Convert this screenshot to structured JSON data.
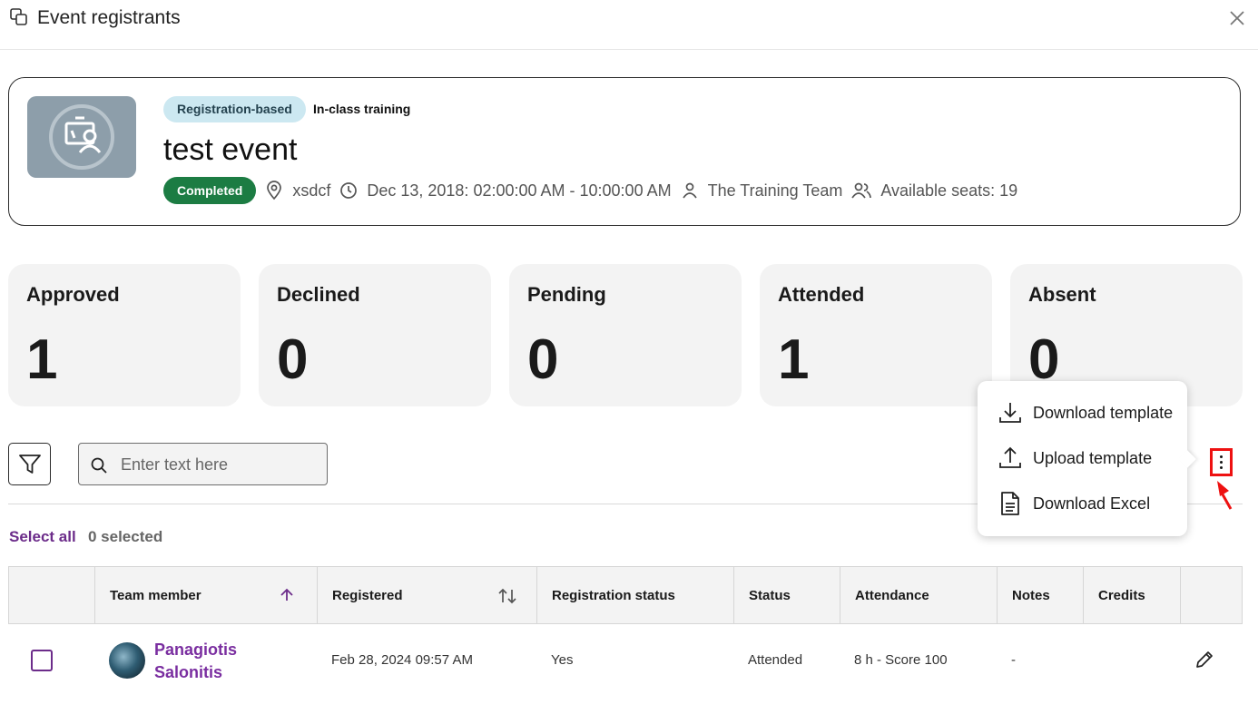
{
  "header": {
    "title": "Event registrants"
  },
  "event": {
    "type_badge": "Registration-based",
    "kind": "In-class training",
    "name": "test event",
    "status_badge": "Completed",
    "location": "xsdcf",
    "datetime": "Dec 13, 2018: 02:00:00 AM - 10:00:00 AM",
    "organizer": "The Training Team",
    "seats": "Available seats: 19"
  },
  "stats": [
    {
      "label": "Approved",
      "value": "1"
    },
    {
      "label": "Declined",
      "value": "0"
    },
    {
      "label": "Pending",
      "value": "0"
    },
    {
      "label": "Attended",
      "value": "1"
    },
    {
      "label": "Absent",
      "value": "0"
    }
  ],
  "toolbar": {
    "search_placeholder": "Enter text here"
  },
  "menu": {
    "items": [
      {
        "label": "Download template",
        "icon": "download-icon"
      },
      {
        "label": "Upload template",
        "icon": "upload-icon"
      },
      {
        "label": "Download Excel",
        "icon": "document-icon"
      }
    ]
  },
  "selection": {
    "select_all": "Select all",
    "count": "0 selected"
  },
  "table": {
    "columns": [
      "Team member",
      "Registered",
      "Registration status",
      "Status",
      "Attendance",
      "Notes",
      "Credits"
    ],
    "rows": [
      {
        "first_name": "Panagiotis",
        "last_name": "Salonitis",
        "registered": "Feb 28, 2024 09:57 AM",
        "registration_status": "Yes",
        "status": "Attended",
        "attendance": "8 h - Score 100",
        "notes": "-",
        "credits": ""
      }
    ]
  },
  "colors": {
    "accent": "#6c2c8a",
    "completed": "#1c7c43",
    "highlight": "#e11111"
  }
}
